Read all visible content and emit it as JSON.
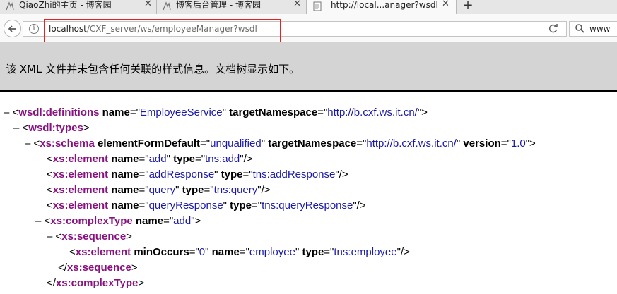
{
  "tabs": [
    {
      "title": "QiaoZhi的主页 - 博客园",
      "close": "✕",
      "active": false
    },
    {
      "title": "博客后台管理 - 博客园",
      "close": "✕",
      "active": false
    },
    {
      "title": "http://local...anager?wsdl",
      "close": "✕",
      "active": true
    }
  ],
  "newtab": "+",
  "address": {
    "host": "localhost",
    "path": "/CXF_server/ws/employeeManager?wsdl",
    "info_glyph": "i"
  },
  "search": {
    "text": "www"
  },
  "banner": {
    "message": "该 XML 文件并未包含任何关联的样式信息。文档树显示如下。"
  },
  "xml": {
    "definitions": {
      "tag": "wsdl:definitions",
      "a1n": "name",
      "a1v": "EmployeeService",
      "a2n": "targetNamespace",
      "a2v": "http://b.cxf.ws.it.cn/"
    },
    "types": {
      "tag": "wsdl:types"
    },
    "schema": {
      "tag": "xs:schema",
      "a1n": "elementFormDefault",
      "a1v": "unqualified",
      "a2n": "targetNamespace",
      "a2v": "http://b.cxf.ws.it.cn/",
      "a3n": "version",
      "a3v": "1.0"
    },
    "elements": [
      {
        "tag": "xs:element",
        "a1n": "name",
        "a1v": "add",
        "a2n": "type",
        "a2v": "tns:add"
      },
      {
        "tag": "xs:element",
        "a1n": "name",
        "a1v": "addResponse",
        "a2n": "type",
        "a2v": "tns:addResponse"
      },
      {
        "tag": "xs:element",
        "a1n": "name",
        "a1v": "query",
        "a2n": "type",
        "a2v": "tns:query"
      },
      {
        "tag": "xs:element",
        "a1n": "name",
        "a1v": "queryResponse",
        "a2n": "type",
        "a2v": "tns:queryResponse"
      }
    ],
    "complextype": {
      "tag": "xs:complexType",
      "a1n": "name",
      "a1v": "add"
    },
    "sequence": {
      "tag": "xs:sequence"
    },
    "seq_element": {
      "tag": "xs:element",
      "a1n": "minOccurs",
      "a1v": "0",
      "a2n": "name",
      "a2v": "employee",
      "a3n": "type",
      "a3v": "tns:employee"
    },
    "sequence_close": {
      "tag": "xs:sequence"
    },
    "complextype_close": {
      "tag": "xs:complexType"
    }
  }
}
